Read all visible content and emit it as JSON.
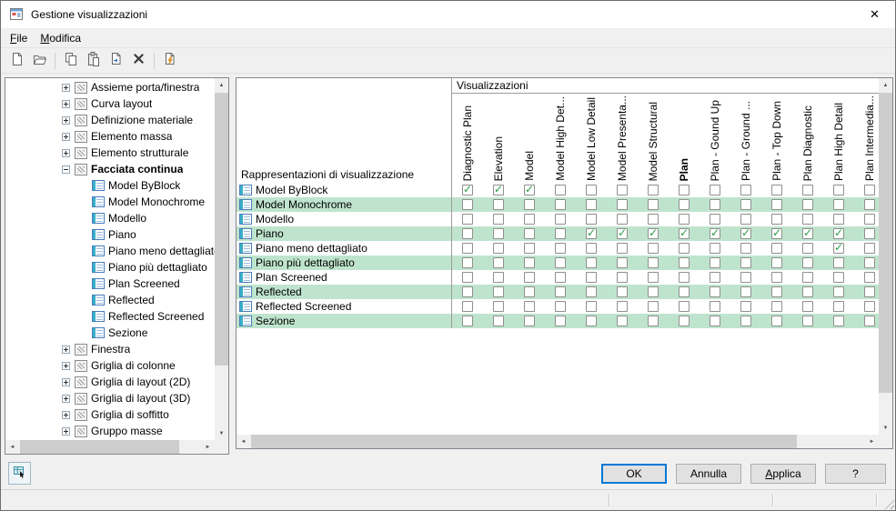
{
  "window": {
    "title": "Gestione visualizzazioni",
    "close_glyph": "✕"
  },
  "menu": {
    "items": [
      {
        "label": "File"
      },
      {
        "label": "Modifica"
      }
    ]
  },
  "toolbar": {
    "buttons": [
      {
        "name": "new"
      },
      {
        "name": "open"
      },
      {
        "name": "copy"
      },
      {
        "name": "paste"
      },
      {
        "name": "paste-special"
      },
      {
        "name": "delete"
      },
      {
        "name": "purge"
      }
    ]
  },
  "tree": {
    "items": [
      {
        "label": "Assieme porta/finestra",
        "icon": "door-window-assembly",
        "expanded": false
      },
      {
        "label": "Curva layout",
        "icon": "layout-curve",
        "expanded": false
      },
      {
        "label": "Definizione materiale",
        "icon": "material-definition",
        "expanded": false
      },
      {
        "label": "Elemento massa",
        "icon": "mass-element",
        "expanded": false
      },
      {
        "label": "Elemento strutturale",
        "icon": "structural-member",
        "expanded": false
      },
      {
        "label": "Facciata continua",
        "icon": "curtain-wall",
        "expanded": true,
        "bold": true,
        "children": [
          "Model ByBlock",
          "Model Monochrome",
          "Modello",
          "Piano",
          "Piano meno dettagliato",
          "Piano più dettagliato",
          "Plan Screened",
          "Reflected",
          "Reflected Screened",
          "Sezione"
        ]
      },
      {
        "label": "Finestra",
        "icon": "window-object",
        "expanded": false
      },
      {
        "label": "Griglia di colonne",
        "icon": "column-grid",
        "expanded": false
      },
      {
        "label": "Griglia di layout (2D)",
        "icon": "layout-grid-2d",
        "expanded": false
      },
      {
        "label": "Griglia di layout (3D)",
        "icon": "layout-grid-3d",
        "expanded": false
      },
      {
        "label": "Griglia di soffitto",
        "icon": "ceiling-grid",
        "expanded": false
      },
      {
        "label": "Gruppo masse",
        "icon": "mass-group",
        "expanded": false
      }
    ]
  },
  "table": {
    "group_header": "Visualizzazioni",
    "row_header": "Rappresentazioni di visualizzazione",
    "columns": [
      {
        "label": "Diagnostic Plan"
      },
      {
        "label": "Elevation"
      },
      {
        "label": "Model"
      },
      {
        "label": "Model High Det..."
      },
      {
        "label": "Model Low Detail"
      },
      {
        "label": "Model Presenta..."
      },
      {
        "label": "Model Structural"
      },
      {
        "label": "Plan",
        "bold": true
      },
      {
        "label": "Plan - Gound Up"
      },
      {
        "label": "Plan - Ground ..."
      },
      {
        "label": "Plan - Top Down"
      },
      {
        "label": "Plan Diagnostic"
      },
      {
        "label": "Plan High Detail"
      },
      {
        "label": "Plan Intermedia..."
      }
    ],
    "rows": [
      {
        "label": "Model ByBlock",
        "checks": [
          1,
          1,
          1,
          0,
          0,
          0,
          0,
          0,
          0,
          0,
          0,
          0,
          0,
          0
        ]
      },
      {
        "label": "Model Monochrome",
        "checks": [
          0,
          0,
          0,
          0,
          0,
          0,
          0,
          0,
          0,
          0,
          0,
          0,
          0,
          0
        ]
      },
      {
        "label": "Modello",
        "checks": [
          0,
          0,
          0,
          0,
          0,
          0,
          0,
          0,
          0,
          0,
          0,
          0,
          0,
          0
        ]
      },
      {
        "label": "Piano",
        "checks": [
          0,
          0,
          0,
          0,
          1,
          1,
          1,
          1,
          1,
          1,
          1,
          1,
          1,
          0
        ]
      },
      {
        "label": "Piano meno dettagliato",
        "checks": [
          0,
          0,
          0,
          0,
          0,
          0,
          0,
          0,
          0,
          0,
          0,
          0,
          1,
          0
        ]
      },
      {
        "label": "Piano più dettagliato",
        "checks": [
          0,
          0,
          0,
          0,
          0,
          0,
          0,
          0,
          0,
          0,
          0,
          0,
          0,
          0
        ]
      },
      {
        "label": "Plan Screened",
        "checks": [
          0,
          0,
          0,
          0,
          0,
          0,
          0,
          0,
          0,
          0,
          0,
          0,
          0,
          0
        ]
      },
      {
        "label": "Reflected",
        "checks": [
          0,
          0,
          0,
          0,
          0,
          0,
          0,
          0,
          0,
          0,
          0,
          0,
          0,
          0
        ]
      },
      {
        "label": "Reflected Screened",
        "checks": [
          0,
          0,
          0,
          0,
          0,
          0,
          0,
          0,
          0,
          0,
          0,
          0,
          0,
          0
        ]
      },
      {
        "label": "Sezione",
        "checks": [
          0,
          0,
          0,
          0,
          0,
          0,
          0,
          0,
          0,
          0,
          0,
          0,
          0,
          0
        ]
      }
    ]
  },
  "buttons": {
    "ok": "OK",
    "cancel": "Annulla",
    "apply": "Applica",
    "help": "?"
  },
  "colors": {
    "row_alt": "#bfe4cd",
    "check_green": "#2c9b45",
    "default_button_border": "#0078d7"
  }
}
